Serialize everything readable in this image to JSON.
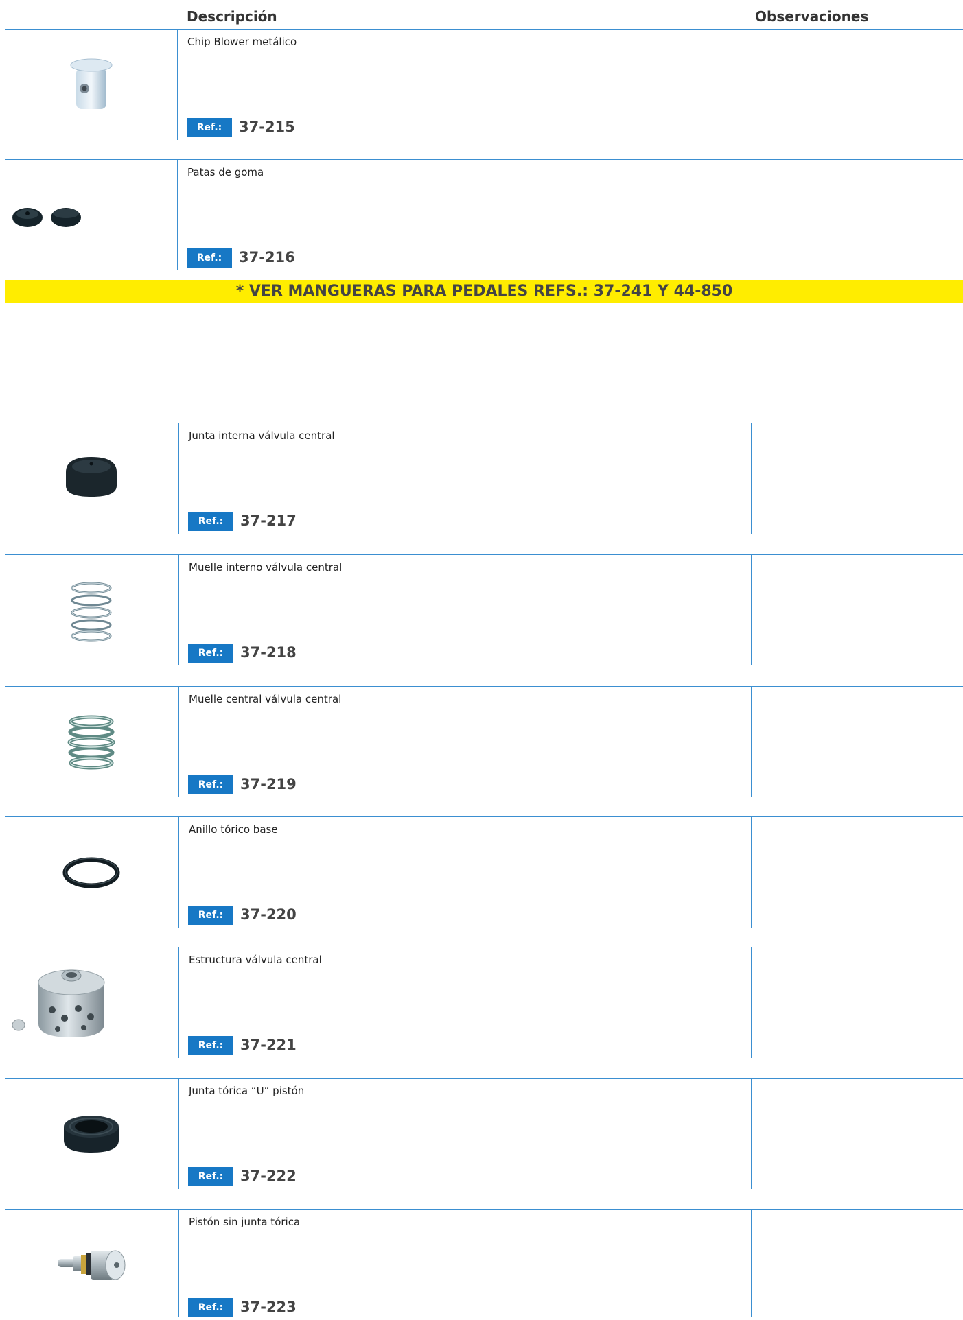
{
  "header": {
    "description": "Descripción",
    "observations": "Observaciones"
  },
  "banner": {
    "text": "* VER MANGUERAS PARA PEDALES REFS.: 37-241 Y 44-850"
  },
  "colors": {
    "accent": "#1778c5",
    "line": "#3b8fd1",
    "banner": "#ffed00"
  },
  "ref_label": "Ref.:",
  "items": [
    {
      "description": "Chip Blower metálico",
      "ref": "37-215",
      "icon": "chip-blower"
    },
    {
      "description": "Patas de goma",
      "ref": "37-216",
      "icon": "rubber-feet"
    },
    {
      "description": "Junta interna válvula central",
      "ref": "37-217",
      "icon": "rubber-cap"
    },
    {
      "description": "Muelle interno válvula central",
      "ref": "37-218",
      "icon": "spring-thin"
    },
    {
      "description": "Muelle central válvula central",
      "ref": "37-219",
      "icon": "spring-thick"
    },
    {
      "description": "Anillo tórico base",
      "ref": "37-220",
      "icon": "o-ring"
    },
    {
      "description": "Estructura válvula central",
      "ref": "37-221",
      "icon": "valve-body"
    },
    {
      "description": "Junta tórica “U” pistón",
      "ref": "37-222",
      "icon": "u-seal"
    },
    {
      "description": "Pistón sin junta tórica",
      "ref": "37-223",
      "icon": "piston"
    }
  ]
}
